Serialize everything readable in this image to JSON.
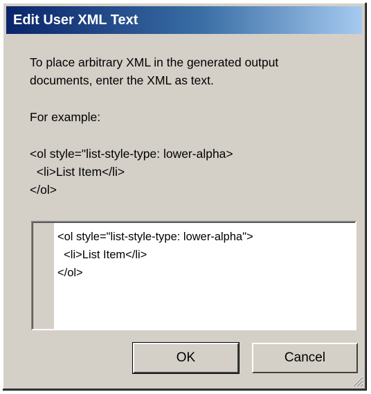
{
  "dialog": {
    "title": "Edit User XML Text"
  },
  "instructions": {
    "line1": "To place arbitrary XML in the generated output",
    "line2": "documents, enter the XML as text.",
    "example_label": "For example:",
    "example_line1": "<ol style=\"list-style-type: lower-alpha>",
    "example_line2": "  <li>List Item</li>",
    "example_line3": "</ol>"
  },
  "editor": {
    "lines": [
      "<ol style=\"list-style-type: lower-alpha\">",
      "  <li>List Item</li>",
      "</ol>"
    ]
  },
  "buttons": {
    "ok": "OK",
    "cancel": "Cancel"
  },
  "icons": {
    "resize_grip": "resize-grip-icon"
  }
}
